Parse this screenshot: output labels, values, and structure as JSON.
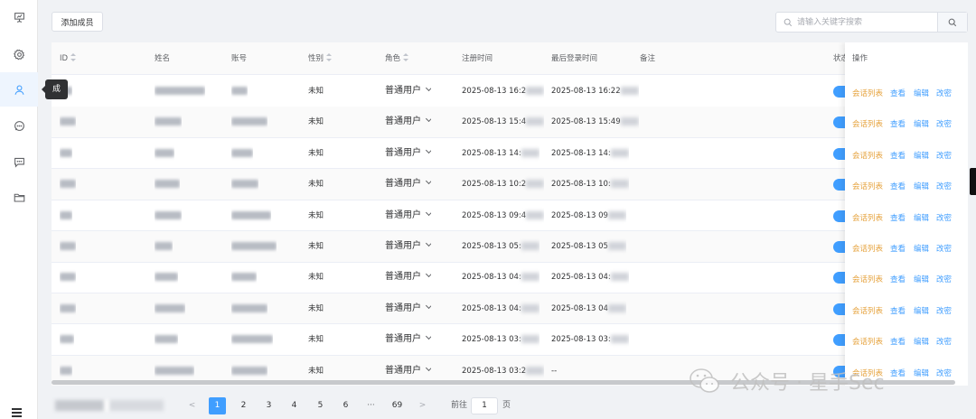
{
  "sidebar": {
    "tooltip": "成",
    "items": [
      {
        "icon": "presentation-icon"
      },
      {
        "icon": "gear-icon"
      },
      {
        "icon": "user-icon",
        "active": true
      },
      {
        "icon": "chat-icon"
      },
      {
        "icon": "message-icon"
      },
      {
        "icon": "folder-icon"
      }
    ]
  },
  "toolbar": {
    "add_label": "添加成员",
    "search_placeholder": "请输入关键字搜索"
  },
  "table": {
    "headers": {
      "id": "ID",
      "name": "姓名",
      "account": "账号",
      "gender": "性别",
      "role": "角色",
      "register_time": "注册时间",
      "last_login": "最后登录时间",
      "remark": "备注",
      "status": "状态",
      "ops": "操作"
    },
    "rows": [
      {
        "gender": "未知",
        "role": "普通用户",
        "reg": "2025-08-13 16:2",
        "login": "2025-08-13 16:22"
      },
      {
        "gender": "未知",
        "role": "普通用户",
        "reg": "2025-08-13 15:4",
        "login": "2025-08-13 15:49"
      },
      {
        "gender": "未知",
        "role": "普通用户",
        "reg": "2025-08-13 14:",
        "login": "2025-08-13 14:"
      },
      {
        "gender": "未知",
        "role": "普通用户",
        "reg": "2025-08-13 10:2",
        "login": "2025-08-13 10:"
      },
      {
        "gender": "未知",
        "role": "普通用户",
        "reg": "2025-08-13 09:4",
        "login": "2025-08-13 09"
      },
      {
        "gender": "未知",
        "role": "普通用户",
        "reg": "2025-08-13 05:",
        "login": "2025-08-13 05"
      },
      {
        "gender": "未知",
        "role": "普通用户",
        "reg": "2025-08-13 04:",
        "login": "2025-08-13 04:"
      },
      {
        "gender": "未知",
        "role": "普通用户",
        "reg": "2025-08-13 04:",
        "login": "2025-08-13 04"
      },
      {
        "gender": "未知",
        "role": "普通用户",
        "reg": "2025-08-13 03:",
        "login": "2025-08-13 03:"
      },
      {
        "gender": "未知",
        "role": "普通用户",
        "reg": "2025-08-13 03:2",
        "login": "--"
      }
    ],
    "ops": {
      "session_list": "会话列表",
      "view": "查看",
      "edit": "编辑",
      "change_password": "改密"
    }
  },
  "pagination": {
    "prev": "<",
    "pages": [
      "1",
      "2",
      "3",
      "4",
      "5",
      "6",
      "···",
      "69"
    ],
    "current": "1",
    "next": ">",
    "goto_prefix": "前往",
    "goto_value": "1",
    "goto_suffix": "页"
  },
  "watermark": {
    "text": "公众号 · 星手Sec"
  },
  "colors": {
    "primary": "#409eff",
    "warning": "#e6a23c",
    "text": "#303133"
  }
}
